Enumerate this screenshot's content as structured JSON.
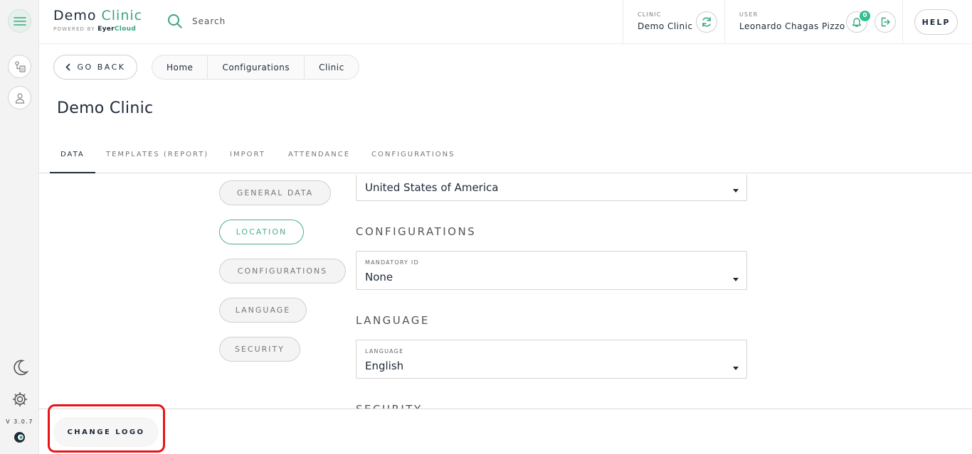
{
  "app": {
    "brand_main": "Demo",
    "brand_accent": "Clinic",
    "powered_by": "POWERED BY",
    "powered_brand_a": "Eyer",
    "powered_brand_b": "Cloud",
    "accent_color": "#3aa57f"
  },
  "header": {
    "search_placeholder": "Search",
    "clinic_label": "CLINIC",
    "clinic_value": "Demo Clinic",
    "user_label": "USER",
    "user_value": "Leonardo Chagas Pizzo",
    "notifications_count": "0",
    "help_label": "HELP"
  },
  "sidebar": {
    "version": "V 3.0.7",
    "icons": [
      "menu-icon",
      "patients-icon",
      "user-icon",
      "dark-mode-icon",
      "settings-icon"
    ]
  },
  "nav": {
    "back_label": "GO BACK",
    "breadcrumbs": [
      "Home",
      "Configurations",
      "Clinic"
    ]
  },
  "page": {
    "title": "Demo Clinic"
  },
  "tabs": [
    "DATA",
    "TEMPLATES (REPORT)",
    "IMPORT",
    "ATTENDANCE",
    "CONFIGURATIONS"
  ],
  "side_nav": [
    "GENERAL DATA",
    "LOCATION",
    "CONFIGURATIONS",
    "LANGUAGE",
    "SECURITY"
  ],
  "form": {
    "country_value": "United States of America",
    "configurations_heading": "CONFIGURATIONS",
    "mandatory_id_label": "MANDATORY ID",
    "mandatory_id_value": "None",
    "language_heading": "LANGUAGE",
    "language_label": "LANGUAGE",
    "language_value": "English",
    "security_heading": "SECURITY"
  },
  "footer": {
    "change_logo_label": "CHANGE LOGO"
  }
}
